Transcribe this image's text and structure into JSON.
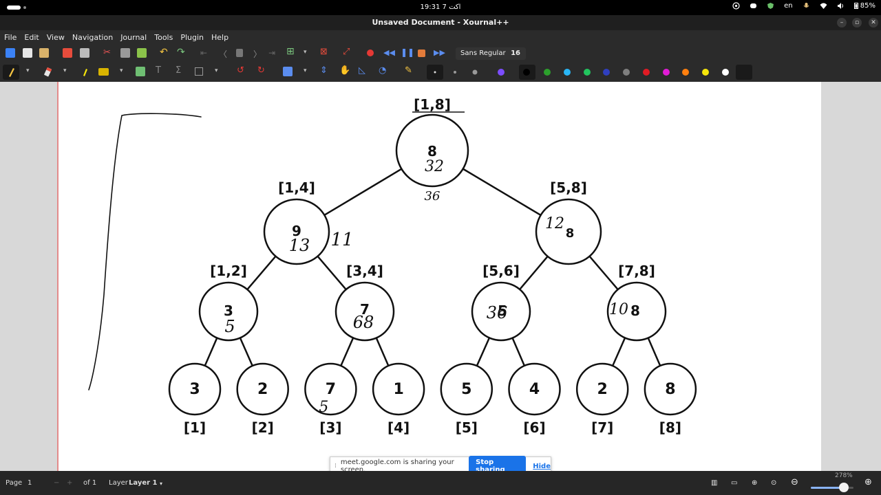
{
  "system": {
    "clock": "19:31  7 اکت",
    "language": "en",
    "battery": "85%"
  },
  "window": {
    "title": "Unsaved Document - Xournal++"
  },
  "menu": [
    "File",
    "Edit",
    "View",
    "Navigation",
    "Journal",
    "Tools",
    "Plugin",
    "Help"
  ],
  "toolbar": {
    "font_name": "Sans Regular",
    "font_size": "16"
  },
  "palette": [
    "#1a1a1a",
    "#2ca02c",
    "#29b6f6",
    "#22c55e",
    "#2f3fbf",
    "#7f7f7f",
    "#e01b24",
    "#e11bd6",
    "#ff7f0e",
    "#f5e50a",
    "#ffffff"
  ],
  "tree": {
    "root": {
      "range": "[1,8]",
      "value": "8",
      "edits": [
        "32",
        "36"
      ]
    },
    "level1": [
      {
        "range": "[1,4]",
        "value": "9",
        "edits": [
          "13",
          "11"
        ]
      },
      {
        "range": "[5,8]",
        "value": "8",
        "edits": [
          "12"
        ]
      }
    ],
    "level2": [
      {
        "range": "[1,2]",
        "value": "3",
        "edits": [
          "5"
        ]
      },
      {
        "range": "[3,4]",
        "value": "7",
        "edits": [
          "68"
        ]
      },
      {
        "range": "[5,6]",
        "value": "5",
        "edits": [
          "36"
        ]
      },
      {
        "range": "[7,8]",
        "value": "8",
        "edits": [
          "10"
        ]
      }
    ],
    "leaves": [
      {
        "index": "[1]",
        "value": "3",
        "edit": ""
      },
      {
        "index": "[2]",
        "value": "2",
        "edit": ""
      },
      {
        "index": "[3]",
        "value": "7",
        "edit": "5"
      },
      {
        "index": "[4]",
        "value": "1",
        "edit": ""
      },
      {
        "index": "[5]",
        "value": "5",
        "edit": ""
      },
      {
        "index": "[6]",
        "value": "4",
        "edit": ""
      },
      {
        "index": "[7]",
        "value": "2",
        "edit": ""
      },
      {
        "index": "[8]",
        "value": "8",
        "edit": ""
      }
    ]
  },
  "share": {
    "message": "meet.google.com is sharing your screen.",
    "stop_label": "Stop sharing",
    "hide_label": "Hide"
  },
  "status": {
    "page_label": "Page",
    "page_value": "1",
    "of_label": "of 1",
    "layer_label": "Layer",
    "layer_value": "Layer 1",
    "zoom": "278%",
    "zoom_level": 0.78
  }
}
